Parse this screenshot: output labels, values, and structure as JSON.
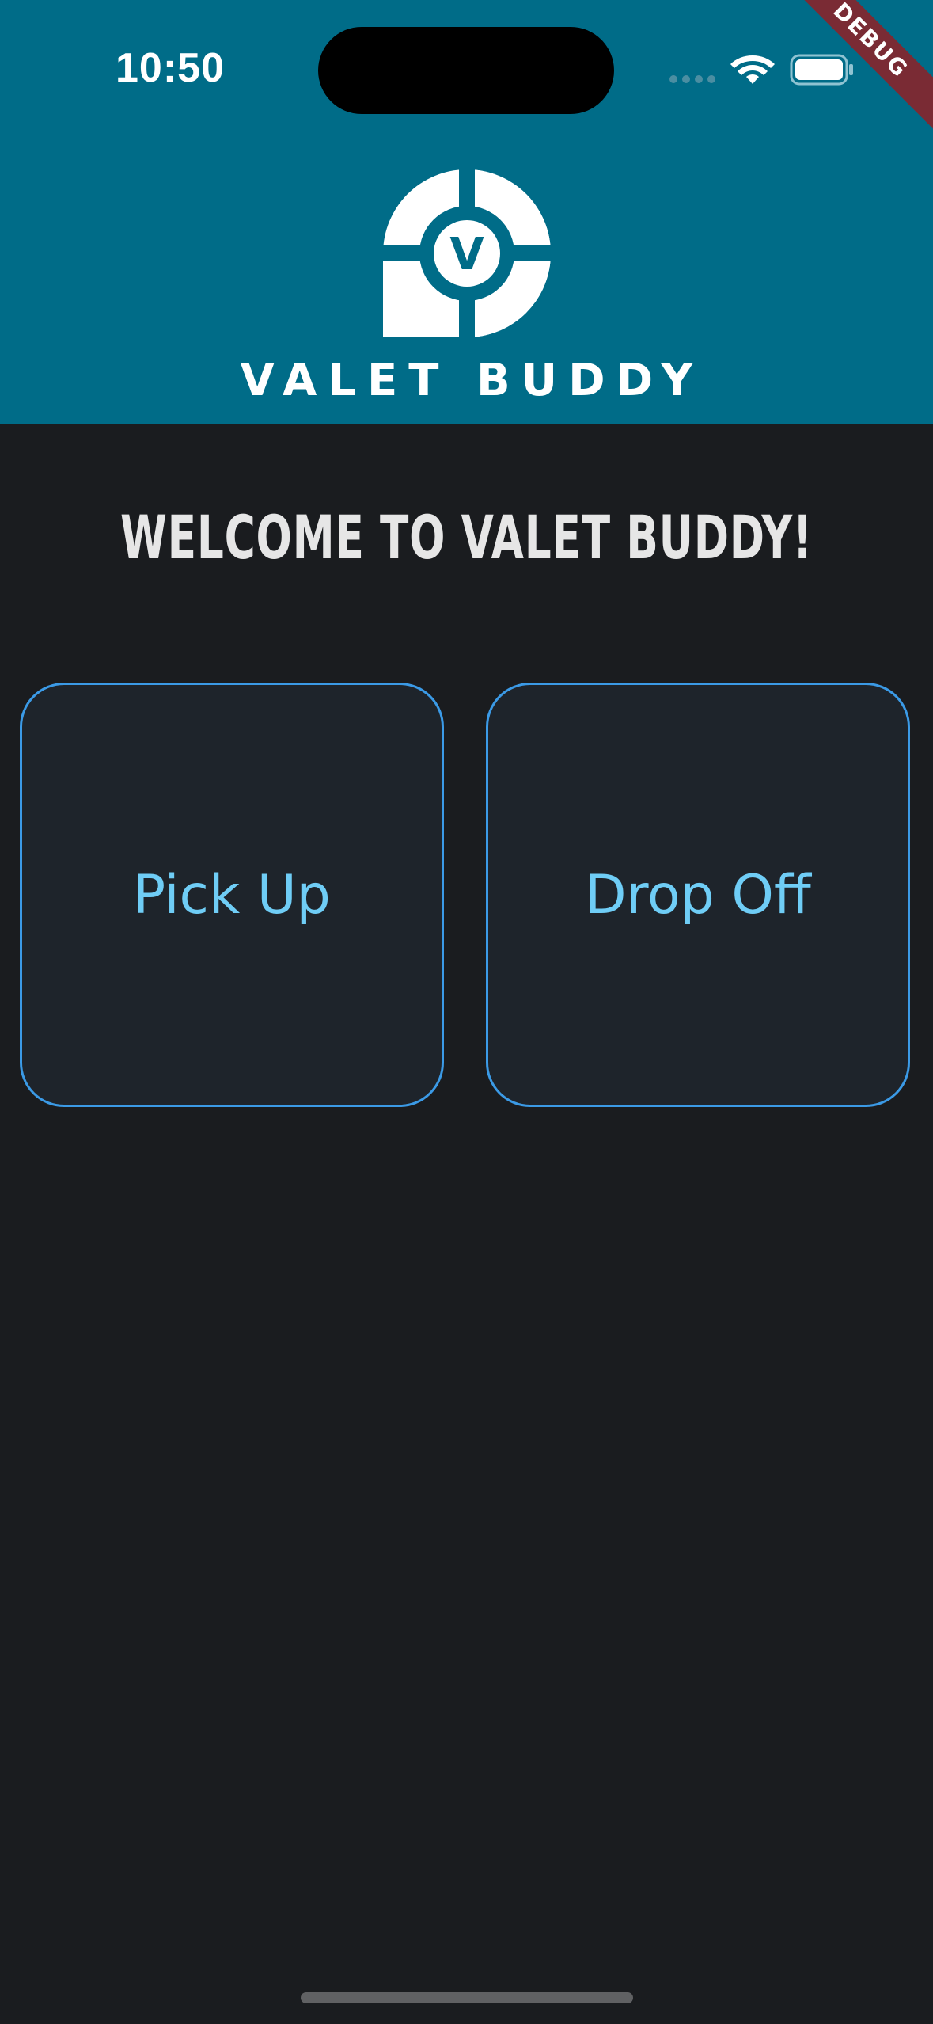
{
  "status_bar": {
    "time": "10:50",
    "icons": [
      "signal-dots-icon",
      "wifi-icon",
      "battery-icon"
    ]
  },
  "debug_banner": {
    "label": "DEBUG"
  },
  "header": {
    "logo_letter": "V",
    "logo_text": "VALET BUDDY",
    "background_color": "#006c88"
  },
  "main": {
    "title": "WELCOME TO VALET BUDDY!",
    "buttons": [
      {
        "label": "Pick Up"
      },
      {
        "label": "Drop Off"
      }
    ]
  },
  "colors": {
    "background": "#1a1c1f",
    "button_border": "#3b9ae6",
    "button_text": "#6fcdf6",
    "debug_banner": "#7a2b34"
  }
}
